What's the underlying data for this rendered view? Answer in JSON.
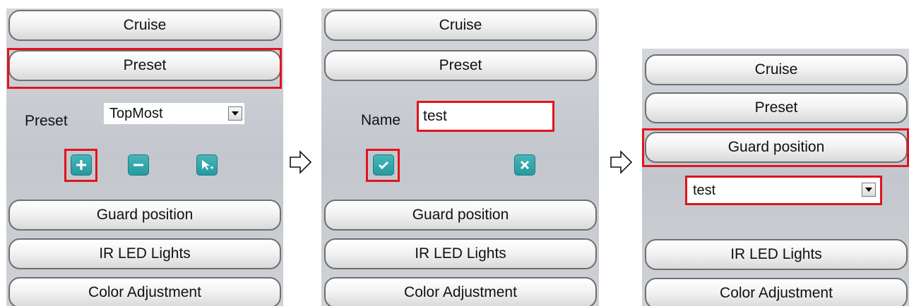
{
  "panel1": {
    "cruise": "Cruise",
    "preset": "Preset",
    "preset_label": "Preset",
    "preset_selected": "TopMost",
    "guard": "Guard position",
    "ir": "IR LED Lights",
    "color": "Color Adjustment"
  },
  "panel2": {
    "cruise": "Cruise",
    "preset": "Preset",
    "name_label": "Name",
    "name_value": "test",
    "guard": "Guard position",
    "ir": "IR LED Lights",
    "color": "Color Adjustment"
  },
  "panel3": {
    "cruise": "Cruise",
    "preset": "Preset",
    "guard": "Guard position",
    "guard_selected": "test",
    "ir": "IR LED Lights",
    "color": "Color Adjustment"
  },
  "colors": {
    "highlight": "#e0141e",
    "teal_button": "#2aa3a8"
  }
}
